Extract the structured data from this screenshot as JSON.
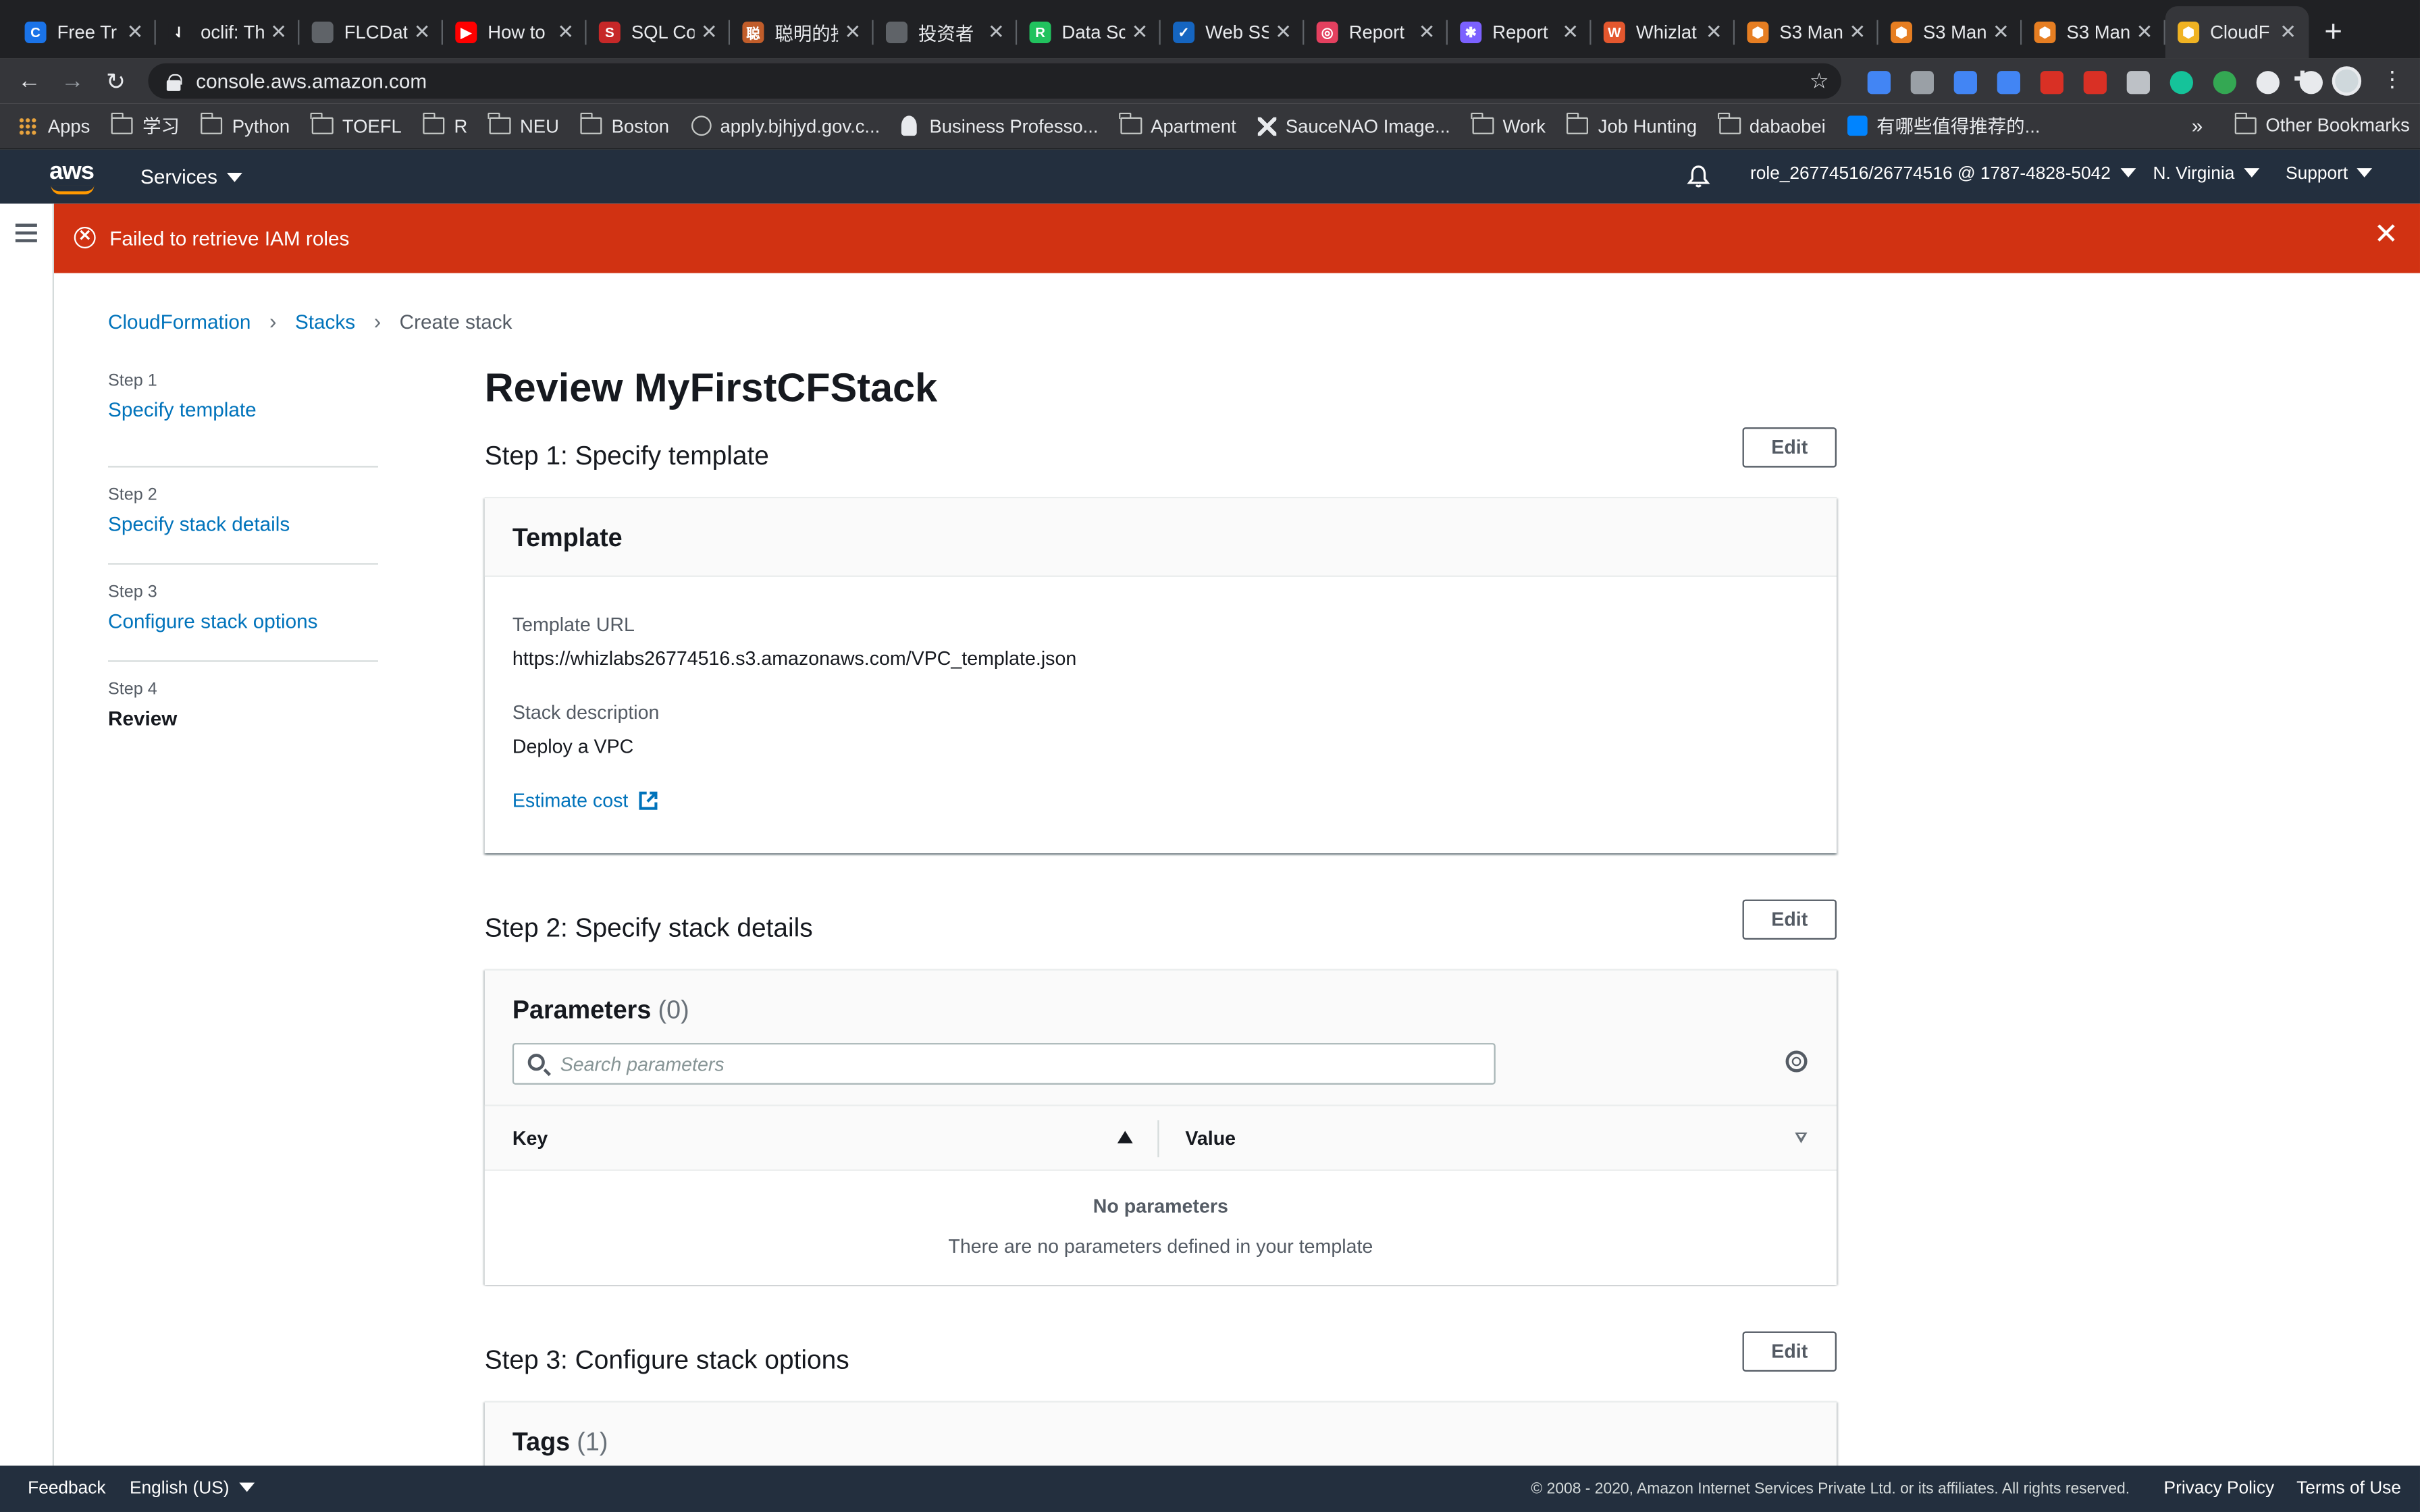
{
  "browser": {
    "tabs": [
      {
        "title": "Free Tr",
        "color": "#1a73e8",
        "glyph": "C"
      },
      {
        "title": "oclif: Th",
        "color": "#202124",
        "glyph": "⇃"
      },
      {
        "title": "FLCDat",
        "color": "#5f6368",
        "glyph": ""
      },
      {
        "title": "How to",
        "color": "#ff0000",
        "glyph": "▶"
      },
      {
        "title": "SQL Co",
        "color": "#c62828",
        "glyph": "S"
      },
      {
        "title": "聪明的投",
        "color": "#c15d2a",
        "glyph": "聪"
      },
      {
        "title": "投资者",
        "color": "#5f6368",
        "glyph": ""
      },
      {
        "title": "Data Sc",
        "color": "#21c25e",
        "glyph": "R"
      },
      {
        "title": "Web SS",
        "color": "#1565c0",
        "glyph": "✓"
      },
      {
        "title": "Report",
        "color": "#e4405f",
        "glyph": "◎"
      },
      {
        "title": "Report",
        "color": "#7b61ff",
        "glyph": "✱"
      },
      {
        "title": "Whizlat",
        "color": "#e4572e",
        "glyph": "W"
      },
      {
        "title": "S3 Man",
        "color": "#e67e22",
        "glyph": "⬢"
      },
      {
        "title": "S3 Man",
        "color": "#e67e22",
        "glyph": "⬢"
      },
      {
        "title": "S3 Man",
        "color": "#e67e22",
        "glyph": "⬢"
      },
      {
        "title": "CloudF",
        "color": "#f0b323",
        "glyph": "⬢"
      }
    ],
    "new_tab_label": "+",
    "close_glyph": "✕",
    "url": "console.aws.amazon.com",
    "bookmarks": [
      {
        "label": "Apps",
        "icon": "apps-icon"
      },
      {
        "label": "学习",
        "icon": "folder-icon"
      },
      {
        "label": "Python",
        "icon": "folder-icon"
      },
      {
        "label": "TOEFL",
        "icon": "folder-icon"
      },
      {
        "label": "R",
        "icon": "folder-icon"
      },
      {
        "label": "NEU",
        "icon": "folder-icon"
      },
      {
        "label": "Boston",
        "icon": "folder-icon"
      },
      {
        "label": "apply.bjhjyd.gov.c...",
        "icon": "globe-icon"
      },
      {
        "label": "Business Professo...",
        "icon": "person-icon"
      },
      {
        "label": "Apartment",
        "icon": "folder-icon"
      },
      {
        "label": "SauceNAO Image...",
        "icon": "x-icon"
      },
      {
        "label": "Work",
        "icon": "folder-icon"
      },
      {
        "label": "Job Hunting",
        "icon": "folder-icon"
      },
      {
        "label": "dabaobei",
        "icon": "folder-icon"
      },
      {
        "label": "有哪些值得推荐的...",
        "icon": "zhihu-icon"
      }
    ],
    "bookmarks_more": "»",
    "other_bookmarks": "Other Bookmarks",
    "extension_colors": [
      "#4285f4",
      "#9aa0a6",
      "#4285f4",
      "#4285f4",
      "#d93025",
      "#d93025",
      "#bdc1c6",
      "#15c39a",
      "#34a853",
      "#e8eaed",
      "#e8eaed"
    ]
  },
  "aws_header": {
    "logo": "aws",
    "services": "Services",
    "account": "role_26774516/26774516 @ 1787-4828-5042",
    "region": "N. Virginia",
    "support": "Support"
  },
  "flash": {
    "message": "Failed to retrieve IAM roles",
    "close": "✕"
  },
  "breadcrumbs": [
    "CloudFormation",
    "Stacks",
    "Create stack"
  ],
  "wizard_steps": [
    {
      "step": "Step 1",
      "name": "Specify template"
    },
    {
      "step": "Step 2",
      "name": "Specify stack details"
    },
    {
      "step": "Step 3",
      "name": "Configure stack options"
    },
    {
      "step": "Step 4",
      "name": "Review"
    }
  ],
  "page_title": "Review MyFirstCFStack",
  "edit_label": "Edit",
  "step1": {
    "heading": "Step 1: Specify template",
    "card_title": "Template",
    "template_url_label": "Template URL",
    "template_url": "https://whizlabs26774516.s3.amazonaws.com/VPC_template.json",
    "stack_desc_label": "Stack description",
    "stack_desc": "Deploy a VPC",
    "estimate_cost": "Estimate cost"
  },
  "step2": {
    "heading": "Step 2: Specify stack details",
    "card_title": "Parameters",
    "count": "(0)",
    "search_placeholder": "Search parameters",
    "col_key": "Key",
    "col_value": "Value",
    "empty_title": "No parameters",
    "empty_desc": "There are no parameters defined in your template"
  },
  "step3": {
    "heading": "Step 3: Configure stack options",
    "card_title": "Tags",
    "count": "(1)"
  },
  "footer": {
    "feedback": "Feedback",
    "language": "English (US)",
    "copyright": "© 2008 - 2020, Amazon Internet Services Private Ltd. or its affiliates. All rights reserved.",
    "privacy": "Privacy Policy",
    "terms": "Terms of Use"
  }
}
